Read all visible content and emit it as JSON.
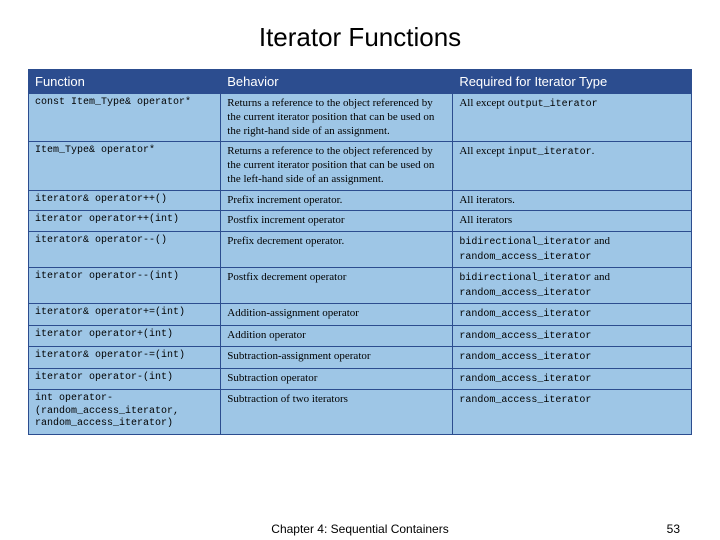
{
  "title": "Iterator Functions",
  "headers": {
    "function": "Function",
    "behavior": "Behavior",
    "required": "Required for Iterator Type"
  },
  "rows": [
    {
      "func": "const Item_Type& operator*",
      "behavior": "Returns a reference to the object referenced by the current iterator position that can be used on the right-hand side of an assignment.",
      "req_pre": "All except ",
      "req_code": "output_iterator"
    },
    {
      "func": "Item_Type& operator*",
      "behavior": "Returns a reference to the object referenced by the current iterator position that can be used on the left-hand side of an assignment.",
      "req_pre": "All except ",
      "req_code": "input_iterator",
      "req_post": "."
    },
    {
      "func": "iterator& operator++()",
      "behavior": "Prefix increment operator.",
      "req_pre": "All iterators.",
      "req_code": ""
    },
    {
      "func": "iterator operator++(int)",
      "behavior": "Postfix increment operator",
      "req_pre": "All iterators",
      "req_code": ""
    },
    {
      "func": "iterator& operator--()",
      "behavior": "Prefix decrement operator.",
      "req_pre": "",
      "req_code": "bidirectional_iterator",
      "req_mid": " and ",
      "req_code2": "random_access_iterator"
    },
    {
      "func": "iterator operator--(int)",
      "behavior": "Postfix decrement operator",
      "req_pre": "",
      "req_code": "bidirectional_iterator",
      "req_mid": " and ",
      "req_code2": "random_access_iterator"
    },
    {
      "func": "iterator& operator+=(int)",
      "behavior": "Addition-assignment operator",
      "req_pre": "",
      "req_code": "random_access_iterator"
    },
    {
      "func": "iterator operator+(int)",
      "behavior": "Addition operator",
      "req_pre": "",
      "req_code": "random_access_iterator"
    },
    {
      "func": "iterator& operator-=(int)",
      "behavior": "Subtraction-assignment operator",
      "req_pre": "",
      "req_code": "random_access_iterator"
    },
    {
      "func": "iterator operator-(int)",
      "behavior": "Subtraction operator",
      "req_pre": "",
      "req_code": "random_access_iterator"
    },
    {
      "func": "int operator-(random_access_iterator, random_access_iterator)",
      "behavior": "Subtraction of two iterators",
      "req_pre": "",
      "req_code": "random_access_iterator"
    }
  ],
  "footer": {
    "center": "Chapter 4: Sequential Containers",
    "page": "53"
  }
}
